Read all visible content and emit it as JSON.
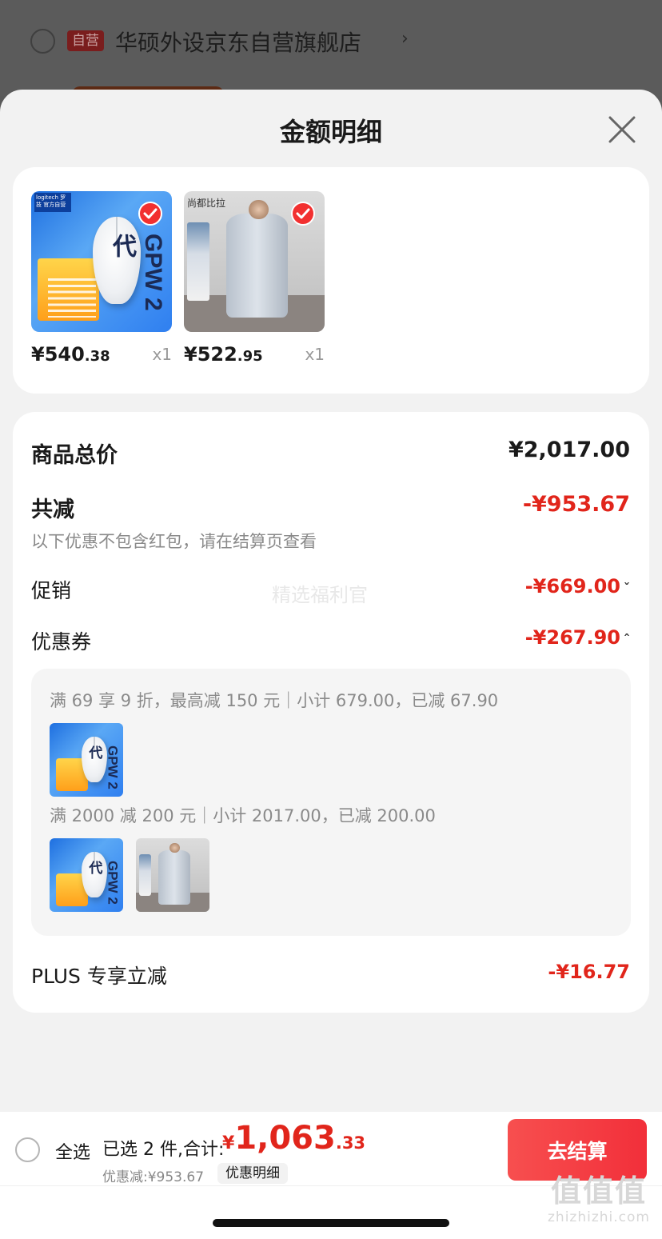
{
  "background": {
    "store_badge": "自营",
    "store_name": "华硕外设京东自营旗舰店"
  },
  "sheet": {
    "title": "金额明细"
  },
  "products": [
    {
      "price_int": "¥540",
      "price_cents": ".38",
      "qty": "x1",
      "checked": true,
      "thumb_logo": "logitech 罗技\n官方自营",
      "thumb_text": "GPW 2代"
    },
    {
      "price_int": "¥522",
      "price_cents": ".95",
      "qty": "x1",
      "checked": true,
      "thumb_brand": "尚都比拉"
    }
  ],
  "details": {
    "total_label": "商品总价",
    "total_value": "¥2,017.00",
    "reduce_label": "共减",
    "reduce_value": "-¥953.67",
    "reduce_hint": "以下优惠不包含红包，请在结算页查看",
    "promo_label": "促销",
    "promo_value": "-¥669.00",
    "promo_caret": "ˇ",
    "coupon_label": "优惠券",
    "coupon_value": "-¥267.90",
    "coupon_caret": "ˆ",
    "watermark": "精选福利官",
    "coupons": [
      {
        "text": "满 69 享 9 折，最高减 150 元｜小计 679.00，已减 67.90"
      },
      {
        "text": "满 2000 减 200 元｜小计 2017.00，已减 200.00"
      }
    ],
    "plus_label": "PLUS 专享立减",
    "plus_value": "-¥16.77"
  },
  "bottom": {
    "select_all": "全选",
    "selected_text": "已选 2 件,合计:",
    "total_symbol": "¥",
    "total_int": "1,063",
    "total_dec": ".33",
    "discount_text": "优惠减:¥953.67",
    "detail_link": "优惠明细",
    "checkout": "去结算",
    "site_glyphs": "值值值",
    "site_domain": "zhizhizhi.com"
  },
  "colors": {
    "accent_red": "#e1251b",
    "checkout_gradient": [
      "#f74f4f",
      "#f22f3a"
    ]
  },
  "icons": {
    "close": "close-icon",
    "check": "check-icon",
    "radio": "radio-unchecked-icon"
  }
}
